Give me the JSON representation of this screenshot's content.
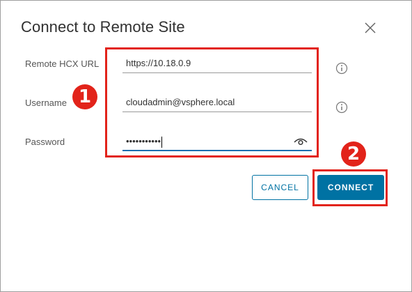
{
  "dialog": {
    "title": "Connect to Remote Site",
    "close_icon": "close-icon"
  },
  "fields": {
    "remote_url": {
      "label": "Remote HCX URL",
      "value": "https://10.18.0.9",
      "info_icon": "info-icon"
    },
    "username": {
      "label": "Username",
      "value": "cloudadmin@vsphere.local",
      "info_icon": "info-icon"
    },
    "password": {
      "label": "Password",
      "value": "•••••••••••",
      "reveal_icon": "eye-icon"
    }
  },
  "buttons": {
    "cancel": "CANCEL",
    "connect": "CONNECT"
  },
  "annotations": {
    "step1": "1",
    "step2": "2"
  },
  "colors": {
    "primary": "#0072a3",
    "annotation": "#e2231a"
  }
}
